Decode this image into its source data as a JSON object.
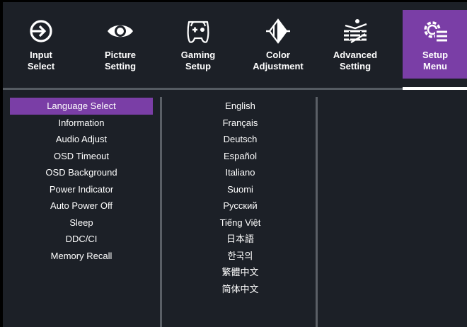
{
  "tabs": [
    {
      "line1": "Input",
      "line2": "Select",
      "icon": "input-arrow-icon",
      "active": false
    },
    {
      "line1": "Picture",
      "line2": "Setting",
      "icon": "eye-icon",
      "active": false
    },
    {
      "line1": "Gaming",
      "line2": "Setup",
      "icon": "gamepad-icon",
      "active": false
    },
    {
      "line1": "Color",
      "line2": "Adjustment",
      "icon": "diamond-color-icon",
      "active": false
    },
    {
      "line1": "Advanced",
      "line2": "Setting",
      "icon": "layers-icon",
      "active": false
    },
    {
      "line1": "Setup",
      "line2": "Menu",
      "icon": "gear-menu-icon",
      "active": true
    }
  ],
  "setup_menu": {
    "selected_index": 0,
    "items": [
      "Language Select",
      "Information",
      "Audio Adjust",
      "OSD Timeout",
      "OSD Background",
      "Power Indicator",
      "Auto Power Off",
      "Sleep",
      "DDC/CI",
      "Memory Recall"
    ]
  },
  "languages": [
    "English",
    "Français",
    "Deutsch",
    "Español",
    "Italiano",
    "Suomi",
    "Русский",
    "Tiếng Việt",
    "日本語",
    "한국의",
    "繁體中文",
    "简体中文"
  ],
  "colors": {
    "background": "#1c2027",
    "accent": "#7a3ea6",
    "text": "#ffffff",
    "divider": "#5a5f66"
  }
}
